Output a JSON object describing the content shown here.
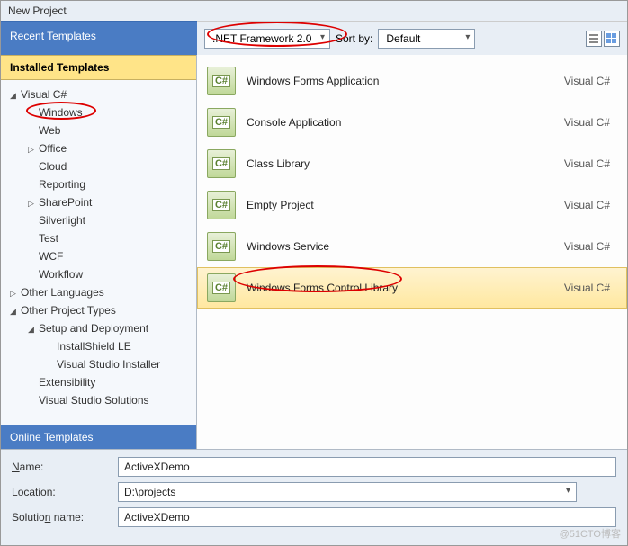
{
  "window_title": "New Project",
  "sidebar": {
    "recent_label": "Recent Templates",
    "installed_label": "Installed Templates",
    "online_label": "Online Templates",
    "tree": [
      {
        "label": "Visual C#",
        "level": 0,
        "expanded": true
      },
      {
        "label": "Windows",
        "level": 1,
        "circled": true
      },
      {
        "label": "Web",
        "level": 1
      },
      {
        "label": "Office",
        "level": 1,
        "expandable": true
      },
      {
        "label": "Cloud",
        "level": 1
      },
      {
        "label": "Reporting",
        "level": 1
      },
      {
        "label": "SharePoint",
        "level": 1,
        "expandable": true
      },
      {
        "label": "Silverlight",
        "level": 1
      },
      {
        "label": "Test",
        "level": 1
      },
      {
        "label": "WCF",
        "level": 1
      },
      {
        "label": "Workflow",
        "level": 1
      },
      {
        "label": "Other Languages",
        "level": 0,
        "expandable": true
      },
      {
        "label": "Other Project Types",
        "level": 0,
        "expanded": true
      },
      {
        "label": "Setup and Deployment",
        "level": 1,
        "expanded": true
      },
      {
        "label": "InstallShield LE",
        "level": 2
      },
      {
        "label": "Visual Studio Installer",
        "level": 2
      },
      {
        "label": "Extensibility",
        "level": 1
      },
      {
        "label": "Visual Studio Solutions",
        "level": 1
      }
    ]
  },
  "toolbar": {
    "framework": ".NET Framework 2.0",
    "sort_label": "Sort by:",
    "sort_value": "Default"
  },
  "templates": [
    {
      "name": "Windows Forms Application",
      "lang": "Visual C#"
    },
    {
      "name": "Console Application",
      "lang": "Visual C#"
    },
    {
      "name": "Class Library",
      "lang": "Visual C#"
    },
    {
      "name": "Empty Project",
      "lang": "Visual C#"
    },
    {
      "name": "Windows Service",
      "lang": "Visual C#"
    },
    {
      "name": "Windows Forms Control Library",
      "lang": "Visual C#",
      "selected": true
    }
  ],
  "fields": {
    "name_label": "Name:",
    "name_value": "ActiveXDemo",
    "location_label": "Location:",
    "location_value": "D:\\projects",
    "solution_label": "Solution name:",
    "solution_value": "ActiveXDemo"
  },
  "watermark": "@51CTO博客"
}
